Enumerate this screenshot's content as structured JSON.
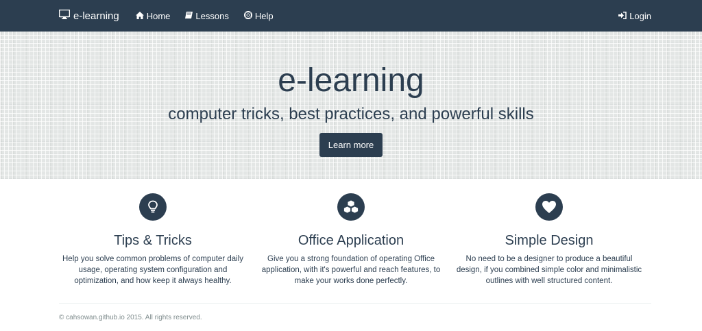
{
  "navbar": {
    "brand": "e-learning",
    "items": [
      {
        "label": "Home",
        "icon": "home-icon"
      },
      {
        "label": "Lessons",
        "icon": "book-icon"
      },
      {
        "label": "Help",
        "icon": "lifebuoy-icon"
      }
    ],
    "login": {
      "label": "Login",
      "icon": "sign-in-icon"
    }
  },
  "hero": {
    "title": "e-learning",
    "subtitle": "computer tricks, best practices, and powerful skills",
    "button": "Learn more"
  },
  "features": [
    {
      "icon": "lightbulb-icon",
      "title": "Tips & Tricks",
      "text": "Help you solve common problems of computer daily usage, operating system configuration and optimization, and how keep it always healthy."
    },
    {
      "icon": "cubes-icon",
      "title": "Office Application",
      "text": "Give you a strong foundation of operating Office application, with it's powerful and reach features, to make your works done perfectly."
    },
    {
      "icon": "heart-icon",
      "title": "Simple Design",
      "text": "No need to be a designer to produce a beautiful design, if you combined simple color and minimalistic outlines with well structured content."
    }
  ],
  "footer": {
    "text": "© cahsowan.github.io 2015. All rights reserved."
  },
  "colors": {
    "primary": "#2c3e50",
    "footer_text": "#7f8c8d"
  }
}
